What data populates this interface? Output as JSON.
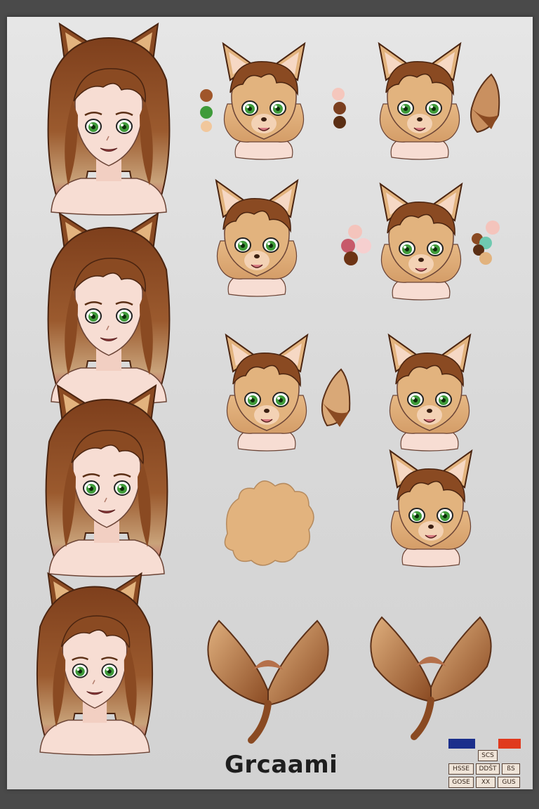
{
  "sheet": {
    "title": "Grcaami",
    "colors": {
      "hair": "#8a4a22",
      "hair_light": "#c9a37a",
      "fur": "#e2b37e",
      "skin": "#f7ddd3",
      "eye": "#3f9b3a",
      "tip": "#c75a6a",
      "blue": "#1b2f8c",
      "red": "#e03a1e"
    },
    "stamps": [
      [
        "",
        "SCS",
        ""
      ],
      [
        "HSSE",
        "DDŠT",
        "ßS"
      ],
      [
        "GOSE",
        "XX",
        "GUS"
      ]
    ]
  }
}
